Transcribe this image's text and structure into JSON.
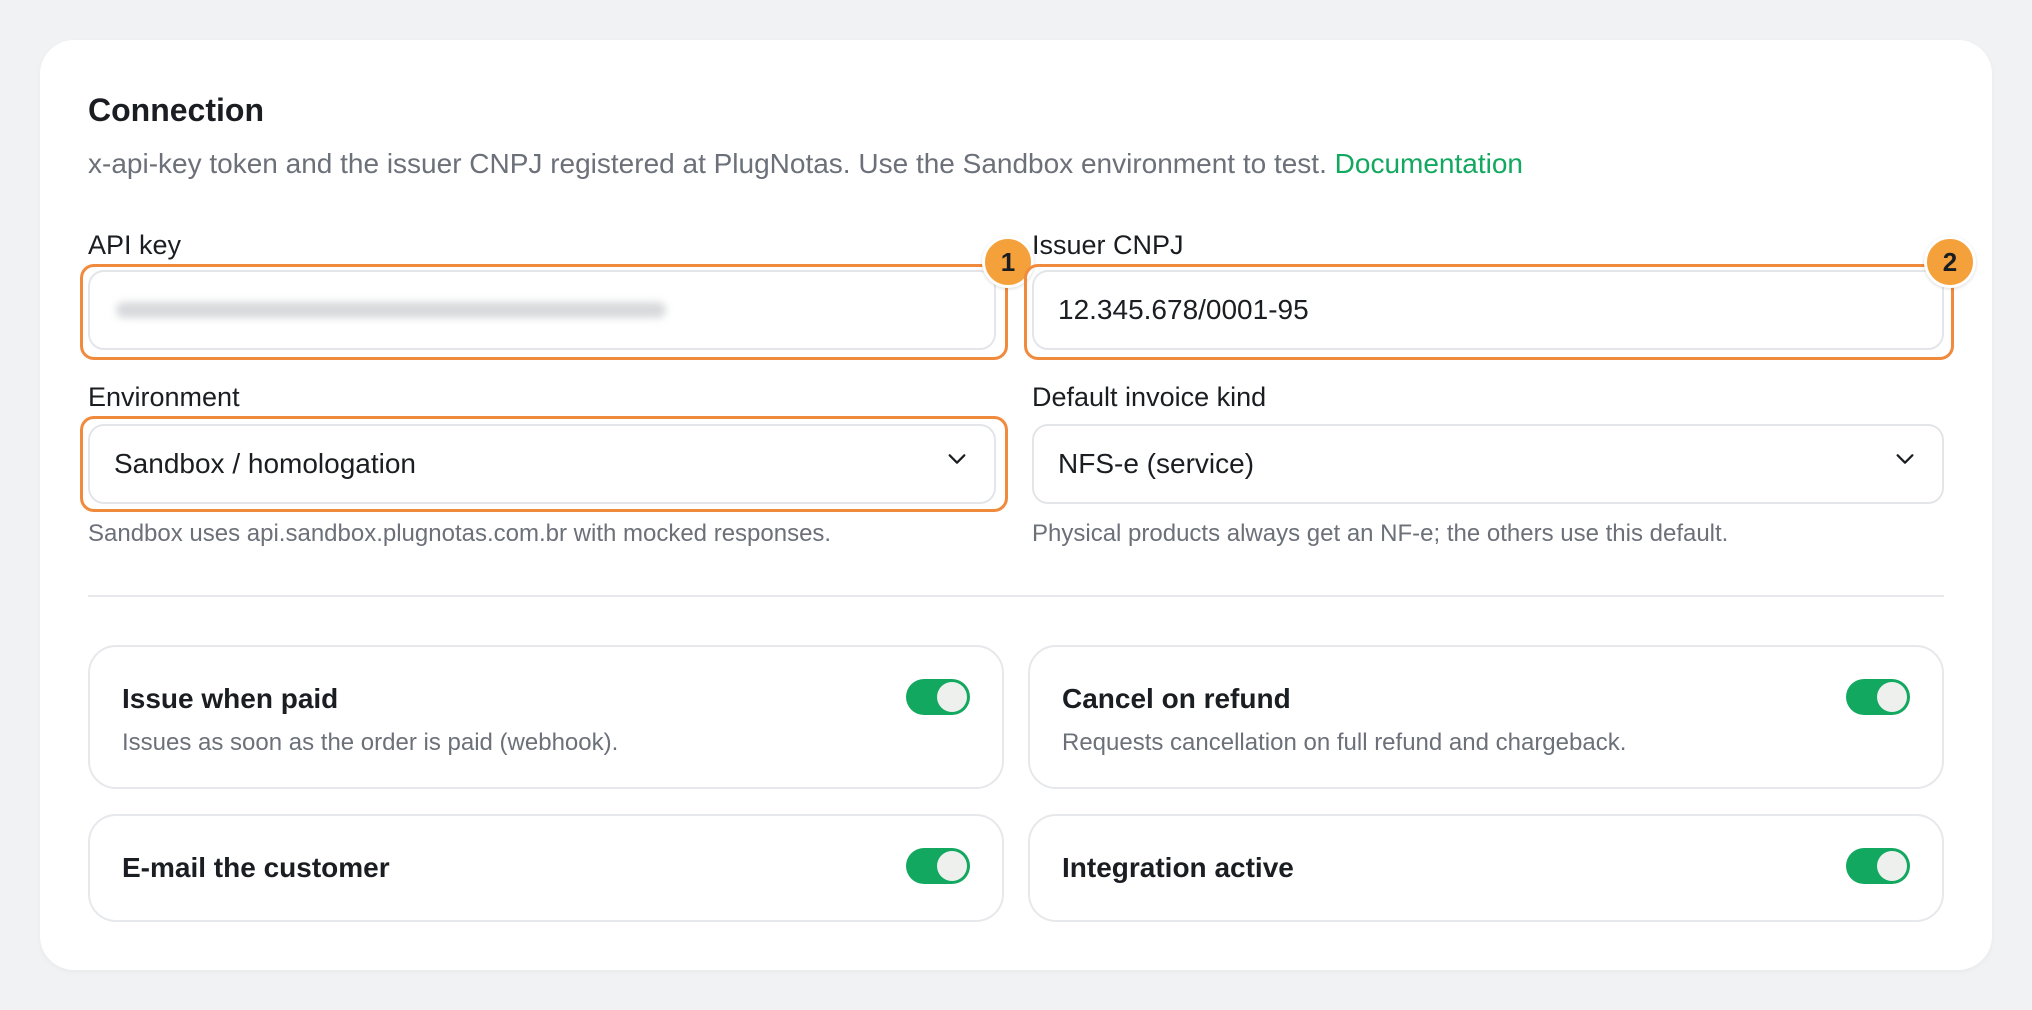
{
  "colors": {
    "accent": "#12a85f",
    "highlight": "#f08a3c",
    "badge": "#f5a13b"
  },
  "connection": {
    "title": "Connection",
    "subtitle": "x-api-key token and the issuer CNPJ registered at PlugNotas. Use the Sandbox environment to test.",
    "doc_link": "Documentation"
  },
  "fields": {
    "api_key": {
      "label": "API key",
      "value": "",
      "masked": true
    },
    "issuer_cnpj": {
      "label": "Issuer CNPJ",
      "value": "12.345.678/0001-95"
    },
    "environment": {
      "label": "Environment",
      "selected": "Sandbox / homologation",
      "hint": "Sandbox uses api.sandbox.plugnotas.com.br with mocked responses.",
      "icon": "chevron-down-icon"
    },
    "invoice_kind": {
      "label": "Default invoice kind",
      "selected": "NFS-e (service)",
      "hint": "Physical products always get an NF-e; the others use this default.",
      "icon": "chevron-down-icon"
    }
  },
  "badges": [
    "1",
    "2"
  ],
  "toggles": [
    {
      "title": "Issue when paid",
      "description": "Issues as soon as the order is paid (webhook).",
      "on": true
    },
    {
      "title": "Cancel on refund",
      "description": "Requests cancellation on full refund and chargeback.",
      "on": true
    },
    {
      "title": "E-mail the customer",
      "description": "",
      "on": true
    },
    {
      "title": "Integration active",
      "description": "",
      "on": true
    }
  ]
}
